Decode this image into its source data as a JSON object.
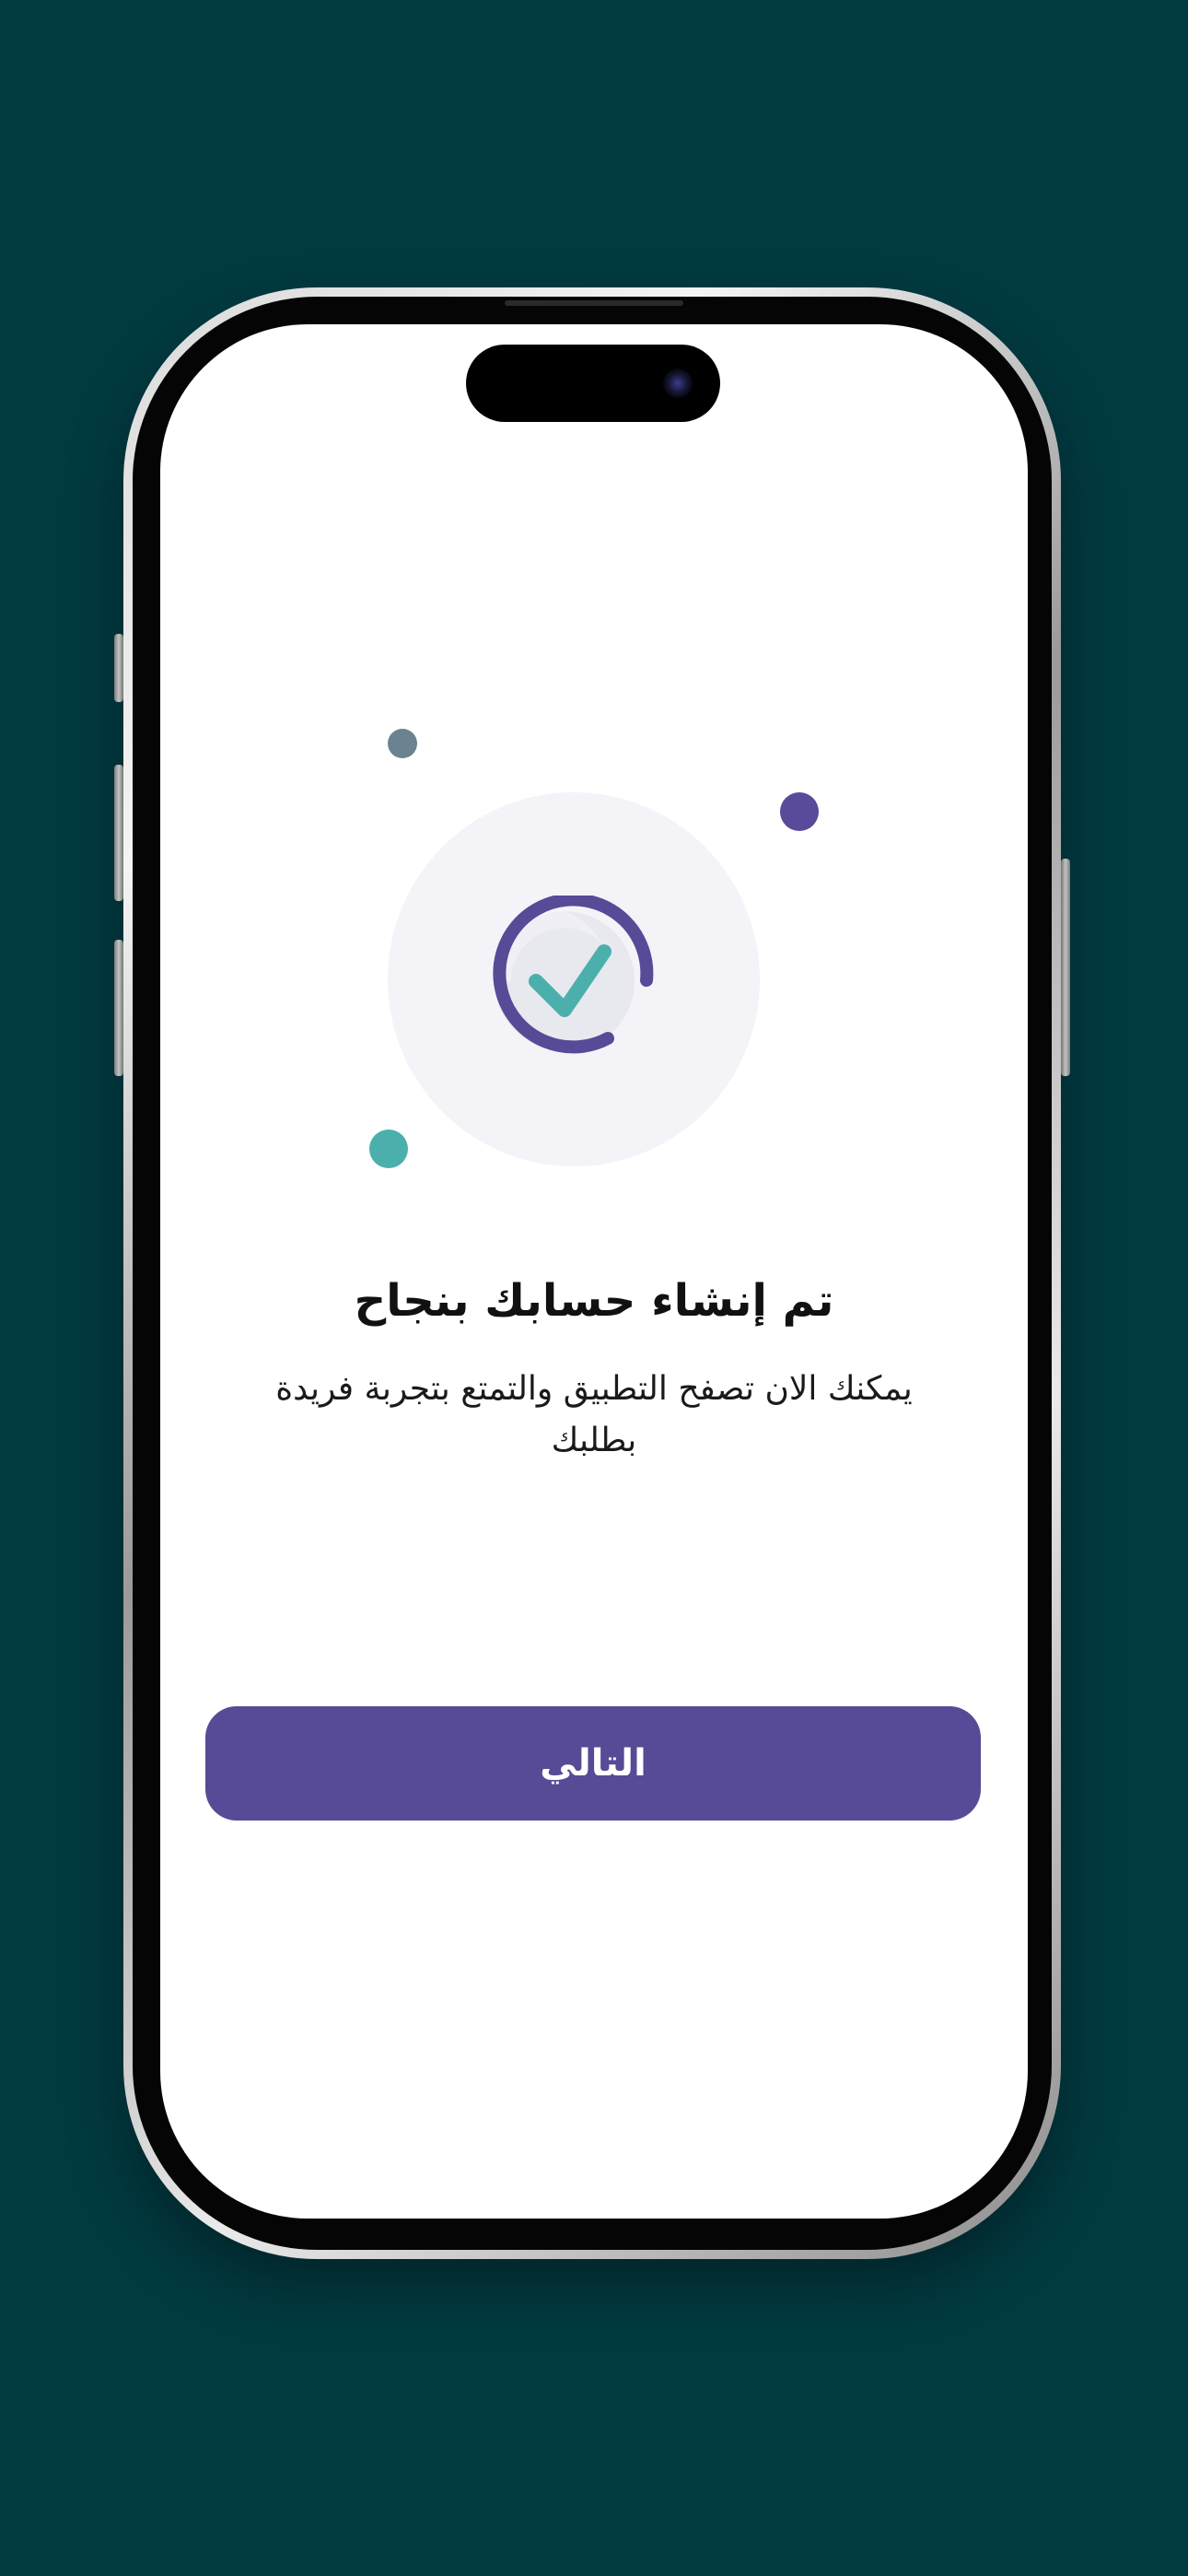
{
  "colors": {
    "background": "#023a41",
    "accent_purple": "#574a96",
    "accent_teal": "#4bb0ac",
    "dot_gray": "#6b8290",
    "halo": "#f3f3f8",
    "screen": "#ffffff"
  },
  "illustration": {
    "icon": "check-circle-icon"
  },
  "success": {
    "title": "تم إنشاء حسابك بنجاح",
    "message": "يمكنك الان تصفح التطبيق والتمتع بتجربة فريدة بطلبك"
  },
  "actions": {
    "next_label": "التالي"
  }
}
